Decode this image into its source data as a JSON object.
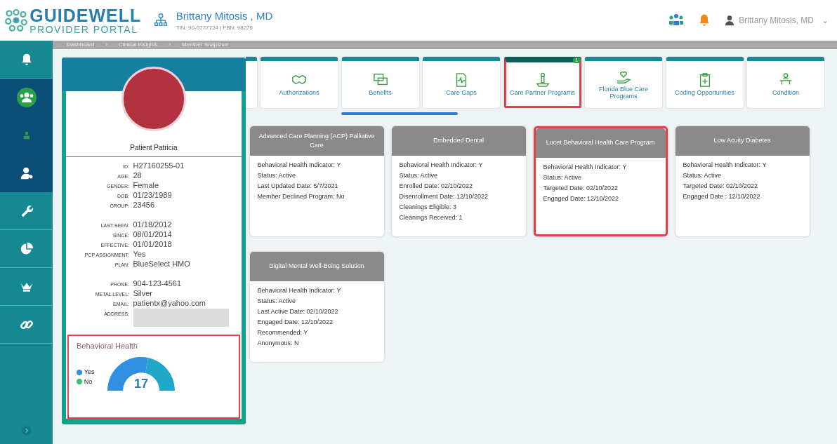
{
  "header": {
    "logo_title": "GUIDEWELL",
    "logo_subtitle": "PROVIDER PORTAL",
    "provider_name": "Brittany Mitosis , MD",
    "provider_ids": "TIN: 90-0777724 | FBN: 98276",
    "user_name": "Brittany Mitosis, MD",
    "menu_caret": "⌄"
  },
  "breadcrumb": {
    "separator": "›",
    "items": [
      "Dashboard",
      "Clinical Insights",
      "Member Snapshot"
    ]
  },
  "sidebar": {
    "items": [
      {
        "selected": false
      },
      {
        "selected": true
      },
      {
        "selected": true
      },
      {
        "selected": true
      },
      {
        "selected": false
      },
      {
        "selected": false
      },
      {
        "selected": false
      },
      {
        "selected": false
      }
    ]
  },
  "patient": {
    "name": "Patient Patricia",
    "field_groups": [
      [
        {
          "label": "ID:",
          "value": "H27160255-01"
        },
        {
          "label": "AGE:",
          "value": "28"
        },
        {
          "label": "GENDER:",
          "value": "Female"
        },
        {
          "label": "DOB:",
          "value": "01/23/1989"
        },
        {
          "label": "GROUP:",
          "value": "23456"
        }
      ],
      [
        {
          "label": "LAST SEEN:",
          "value": "01/18/2012"
        },
        {
          "label": "SINCE:",
          "value": "08/01/2014"
        },
        {
          "label": "EFFECTIVE:",
          "value": "01/01/2018"
        },
        {
          "label": "PCP ASSIGNMENT:",
          "value": "Yes"
        },
        {
          "label": "PLAN:",
          "value": "BlueSelect HMO"
        }
      ],
      [
        {
          "label": "PHONE:",
          "value": "904-123-4561"
        },
        {
          "label": "METAL LEVEL:",
          "value": "Silver"
        },
        {
          "label": "EMAIL:",
          "value": "patientx@yahoo.com"
        },
        {
          "label": "ADDRESS:"
        }
      ]
    ]
  },
  "behavioral_health": {
    "title": "Behavioral Health",
    "highlighted": true,
    "legend": [
      {
        "label": "Yes",
        "color": "#2f8fe0"
      },
      {
        "label": "No",
        "color": "#3cbf7a"
      }
    ],
    "value": "17"
  },
  "tabs": [
    {
      "selected": false
    },
    {
      "label": "Authorizations",
      "selected": false
    },
    {
      "label": "Benefits",
      "selected": false
    },
    {
      "label": "Care Gaps",
      "selected": false
    },
    {
      "label": "Care Partner Programs",
      "selected": true,
      "badge": "1"
    },
    {
      "label": "Florida Blue Care Programs",
      "selected": false
    },
    {
      "label": "Coding Opportunities",
      "selected": false
    },
    {
      "label": "Condition",
      "selected": false
    }
  ],
  "programs": [
    {
      "title": "Advanced Care Planning (ACP) Palliative Care",
      "highlighted": false,
      "lines": [
        "Behavioral Health Indicator: Y",
        "Status: Active",
        "Last Updated Date: 5/7/2021",
        "Member Declined Program: No"
      ]
    },
    {
      "title": "Embedded Dental",
      "highlighted": false,
      "lines": [
        "Behavioral Health Indicator: Y",
        "Status: Active",
        "Enrolled Date: 02/10/2022",
        "Disenrollment Date: 12/10/2022",
        "Cleanings Eligible: 3",
        "Cleanings Received: 1"
      ]
    },
    {
      "title": "Lucet Behavioral Health Care Program",
      "highlighted": true,
      "lines": [
        "Behavioral Health Indicator: Y",
        "Status: Active",
        "Targeted Date: 02/10/2022",
        "Engaged Date: 12/10/2022"
      ]
    },
    {
      "title": "Low Acuity Diabetes",
      "highlighted": false,
      "lines": [
        "Behavioral Health Indicator: Y",
        "Status: Active",
        "Targeted Date: 02/10/2022",
        "Engaged Date : 12/10/2022"
      ]
    },
    {
      "title": "Digital Mental Well-Being Solution",
      "highlighted": false,
      "lines": [
        "Behavioral Health Indicator: Y",
        "Status: Active",
        "Last Active Date: 02/10/2022",
        "Engaged Date: 12/10/2022",
        "Recommended: Y",
        "Anonymous: N"
      ]
    }
  ]
}
